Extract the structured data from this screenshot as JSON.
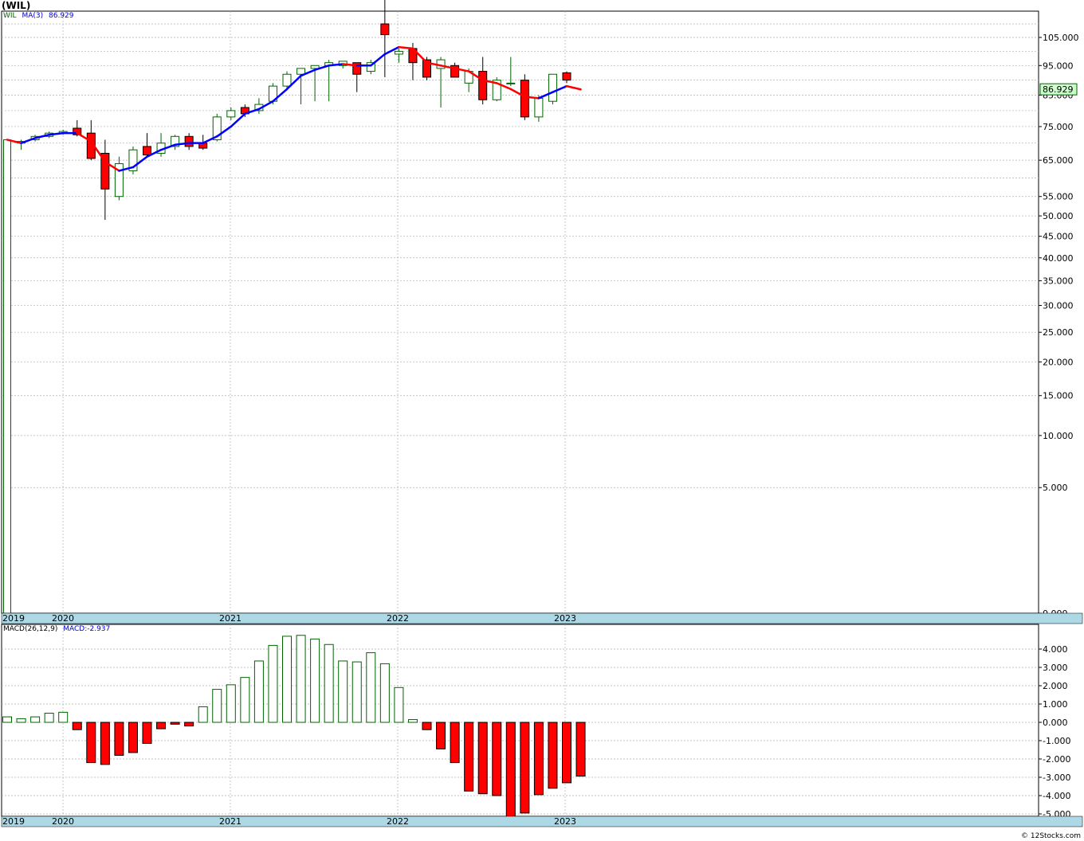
{
  "header": {
    "title": "(WIL)",
    "price_legend_ticker": "WIL",
    "price_legend_ma": "MA(3)",
    "price_legend_ma_value": "86.929",
    "macd_legend_label": "MACD(26,12,9)",
    "macd_legend_value": "MACD:-2.937",
    "footer": "© 12Stocks.com"
  },
  "colors": {
    "up": "#006400",
    "down": "#ff0000",
    "ma_up": "#0000ff",
    "ma_down": "#ff0000",
    "axis_band": "#add8e6",
    "grid": "#999999",
    "last_price_box": "#ccffcc"
  },
  "chart_data": [
    {
      "type": "candlestick",
      "title": "(WIL)",
      "y_scale": "sqrt",
      "ylim": [
        0,
        120
      ],
      "y_ticks": [
        "105.000",
        "95.000",
        "85.000",
        "75.000",
        "65.000",
        "55.000",
        "50.000",
        "45.000",
        "40.000",
        "35.000",
        "30.000",
        "25.000",
        "20.000",
        "15.000",
        "10.000",
        "5.000",
        "0.000"
      ],
      "x_tick_labels": [
        "2019",
        "2020",
        "2021",
        "2022",
        "2023"
      ],
      "last_value_label": "86.929",
      "series": [
        {
          "name": "WIL",
          "candles": [
            {
              "o": 0,
              "h": 71,
              "l": 0,
              "c": 71
            },
            {
              "o": 70,
              "h": 71,
              "l": 68,
              "c": 70.5
            },
            {
              "o": 71,
              "h": 72.5,
              "l": 70.5,
              "c": 72
            },
            {
              "o": 72,
              "h": 73.5,
              "l": 71.5,
              "c": 73
            },
            {
              "o": 73,
              "h": 74,
              "l": 72.5,
              "c": 73.5
            },
            {
              "o": 74.5,
              "h": 77,
              "l": 72,
              "c": 72.5
            },
            {
              "o": 73,
              "h": 77,
              "l": 65,
              "c": 65.5
            },
            {
              "o": 67,
              "h": 71,
              "l": 49,
              "c": 57
            },
            {
              "o": 55,
              "h": 66,
              "l": 54,
              "c": 64
            },
            {
              "o": 62,
              "h": 69,
              "l": 61,
              "c": 68
            },
            {
              "o": 69,
              "h": 73,
              "l": 66,
              "c": 66.5
            },
            {
              "o": 67,
              "h": 73,
              "l": 66,
              "c": 70
            },
            {
              "o": 69,
              "h": 72.5,
              "l": 68,
              "c": 72
            },
            {
              "o": 72,
              "h": 73,
              "l": 68,
              "c": 69
            },
            {
              "o": 70,
              "h": 72.5,
              "l": 68,
              "c": 68.5
            },
            {
              "o": 71,
              "h": 79,
              "l": 70.5,
              "c": 78
            },
            {
              "o": 78,
              "h": 81,
              "l": 77,
              "c": 80
            },
            {
              "o": 81,
              "h": 82,
              "l": 78,
              "c": 79
            },
            {
              "o": 80,
              "h": 84,
              "l": 79,
              "c": 82
            },
            {
              "o": 83,
              "h": 89,
              "l": 82,
              "c": 88
            },
            {
              "o": 88,
              "h": 93,
              "l": 87,
              "c": 92
            },
            {
              "o": 92,
              "h": 94,
              "l": 82,
              "c": 94
            },
            {
              "o": 94,
              "h": 95,
              "l": 83,
              "c": 95
            },
            {
              "o": 95,
              "h": 97,
              "l": 83,
              "c": 96
            },
            {
              "o": 95,
              "h": 96.5,
              "l": 94,
              "c": 96.5
            },
            {
              "o": 96,
              "h": 96,
              "l": 86,
              "c": 92
            },
            {
              "o": 93,
              "h": 97,
              "l": 92,
              "c": 96
            },
            {
              "o": 110,
              "h": 120,
              "l": 91,
              "c": 106
            },
            {
              "o": 99,
              "h": 101,
              "l": 96,
              "c": 100
            },
            {
              "o": 101,
              "h": 103,
              "l": 90,
              "c": 96
            },
            {
              "o": 97,
              "h": 98,
              "l": 90,
              "c": 91
            },
            {
              "o": 94,
              "h": 98,
              "l": 81,
              "c": 97
            },
            {
              "o": 95,
              "h": 96,
              "l": 91,
              "c": 91
            },
            {
              "o": 89,
              "h": 94,
              "l": 86,
              "c": 93
            },
            {
              "o": 93,
              "h": 98,
              "l": 82,
              "c": 83.5
            },
            {
              "o": 83.5,
              "h": 91,
              "l": 83,
              "c": 90
            },
            {
              "o": 89,
              "h": 98,
              "l": 88,
              "c": 89
            },
            {
              "o": 90,
              "h": 92,
              "l": 77,
              "c": 78
            },
            {
              "o": 78,
              "h": 85,
              "l": 76.5,
              "c": 84
            },
            {
              "o": 83,
              "h": 92,
              "l": 82,
              "c": 92
            },
            {
              "o": 92.5,
              "h": 93,
              "l": 89,
              "c": 90
            }
          ]
        },
        {
          "name": "MA(3)",
          "values": [
            71,
            70,
            71.5,
            72.5,
            73,
            73,
            70.5,
            64.5,
            62,
            63,
            66,
            68,
            69.5,
            70,
            70,
            72,
            75,
            79,
            80.5,
            83,
            87,
            91.5,
            93.5,
            95,
            95.5,
            95,
            95,
            99,
            101.5,
            101,
            96,
            95,
            94,
            93,
            90,
            89,
            87,
            84.5,
            84,
            86,
            88,
            86.9
          ]
        }
      ]
    },
    {
      "type": "bar",
      "title": "MACD(26,12,9)",
      "ylim": [
        -5.2,
        4.9
      ],
      "y_ticks": [
        "4.000",
        "3.000",
        "2.000",
        "1.000",
        "0.000",
        "-1.000",
        "-2.000",
        "-3.000",
        "-4.000",
        "-5.000"
      ],
      "x_tick_labels": [
        "2019",
        "2020",
        "2021",
        "2022",
        "2023"
      ],
      "series": [
        {
          "name": "MACD",
          "values": [
            0.3,
            0.2,
            0.3,
            0.5,
            0.55,
            -0.4,
            -2.2,
            -2.3,
            -1.8,
            -1.65,
            -1.15,
            -0.35,
            -0.1,
            -0.2,
            0.85,
            1.8,
            2.05,
            2.45,
            3.35,
            4.2,
            4.7,
            4.75,
            4.55,
            4.25,
            3.35,
            3.3,
            3.8,
            3.2,
            1.9,
            0.15,
            -0.4,
            -1.45,
            -2.2,
            -3.75,
            -3.9,
            -4.0,
            -5.2,
            -4.95,
            -3.95,
            -3.6,
            -3.3,
            -2.937
          ]
        }
      ]
    }
  ]
}
